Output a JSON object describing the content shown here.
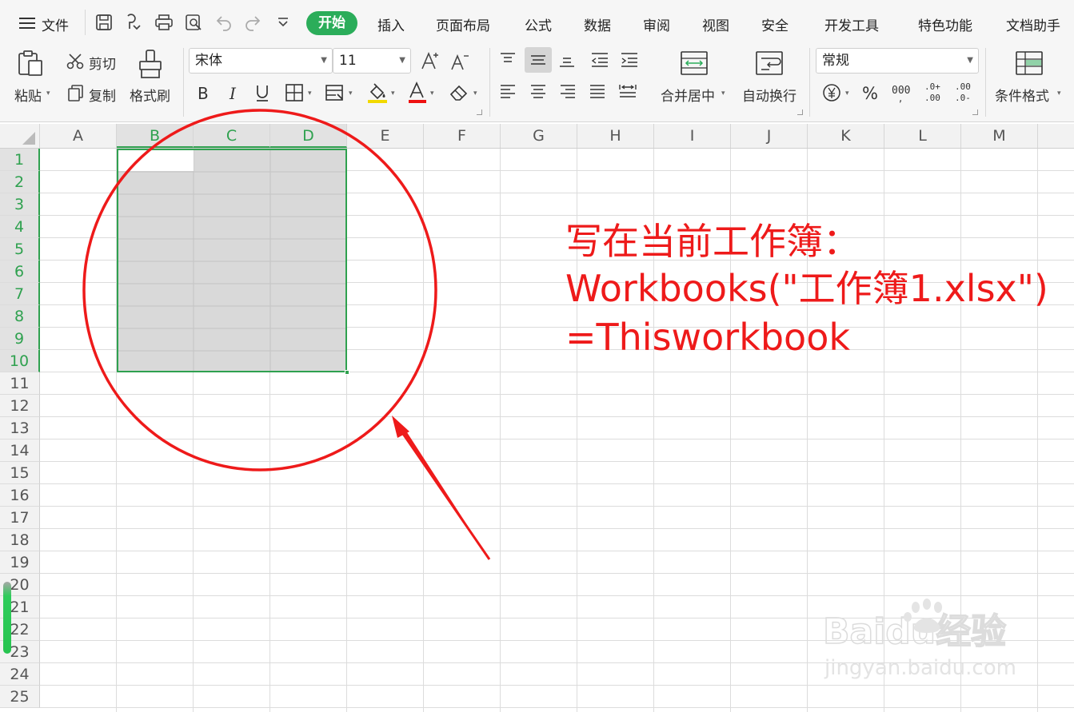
{
  "menubar": {
    "file_label": "文件",
    "tabs": [
      "开始",
      "插入",
      "页面布局",
      "公式",
      "数据",
      "审阅",
      "视图",
      "安全",
      "开发工具",
      "特色功能",
      "文档助手"
    ]
  },
  "ribbon": {
    "paste": "粘贴",
    "cut": "剪切",
    "copy": "复制",
    "format_painter": "格式刷",
    "font_name": "宋体",
    "font_size": "11",
    "merge_center": "合并居中",
    "wrap_text": "自动换行",
    "number_format": "常规",
    "conditional_format": "条件格式"
  },
  "sheet": {
    "columns": [
      "A",
      "B",
      "C",
      "D",
      "E",
      "F",
      "G",
      "H",
      "I",
      "J",
      "K",
      "L",
      "M"
    ],
    "rows": [
      "1",
      "2",
      "3",
      "4",
      "5",
      "6",
      "7",
      "8",
      "9",
      "10",
      "11",
      "12",
      "13",
      "14",
      "15",
      "16",
      "17",
      "18",
      "19",
      "20",
      "21",
      "22",
      "23",
      "24",
      "25"
    ],
    "selected_range": "B1:D10"
  },
  "annotation": {
    "line1": "写在当前工作簿：",
    "line2": "Workbooks(\"工作簿1.xlsx\")",
    "line3": "=Thisworkbook",
    "color": "#ee1a1a"
  },
  "watermark": {
    "brand": "Baidu经验",
    "url": "jingyan.baidu.com"
  },
  "colors": {
    "accent_green": "#2bad5a",
    "selection_fill": "#d9d9d9",
    "annotation_red": "#ee1a1a"
  }
}
